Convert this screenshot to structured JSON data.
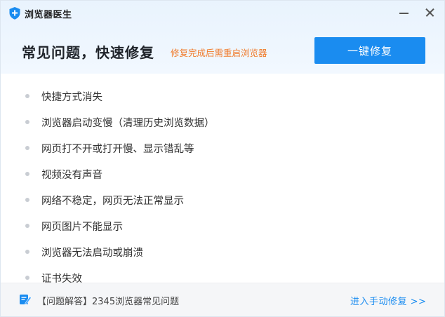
{
  "app": {
    "title": "浏览器医生",
    "icon": "shield-plus-icon",
    "accent_color": "#1a8cf0"
  },
  "window_controls": {
    "minimize_icon": "minimize-icon",
    "close_icon": "close-icon"
  },
  "header": {
    "headline": "常见问题，快速修复",
    "note": "修复完成后需重启浏览器",
    "note_color": "#f07a2a",
    "fix_button_label": "一键修复"
  },
  "issues": [
    "快捷方式消失",
    "浏览器启动变慢（清理历史浏览数据）",
    "网页打不开或打开慢、显示错乱等",
    "视频没有声音",
    "网络不稳定，网页无法正常显示",
    "网页图片不能显示",
    "浏览器无法启动或崩溃",
    "证书失效"
  ],
  "footer": {
    "faq_icon": "document-edit-icon",
    "faq_link": "【问题解答】2345浏览器常见问题",
    "manual_fix_link": "进入手动修复 >>"
  }
}
